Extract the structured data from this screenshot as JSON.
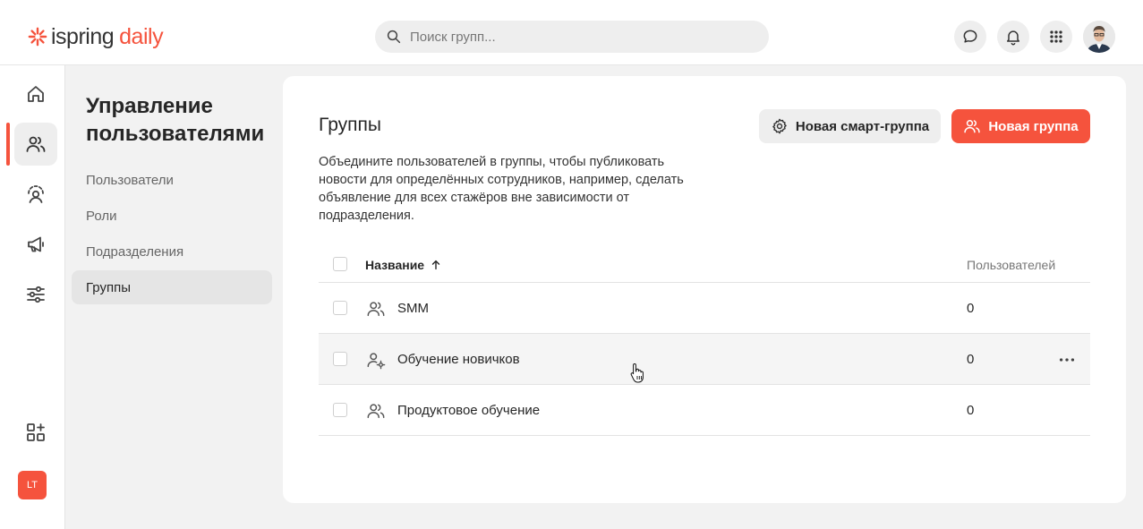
{
  "brand": {
    "name_part1": "ispring",
    "name_part2": "daily",
    "accent": "#f5533d"
  },
  "search": {
    "placeholder": "Поиск групп..."
  },
  "header_icons": [
    "chat-icon",
    "bell-icon",
    "apps-grid-icon"
  ],
  "rail": {
    "items": [
      "home-icon",
      "users-icon",
      "trainee-icon",
      "megaphone-icon",
      "settings-sliders-icon"
    ],
    "active": "users-icon",
    "bottom_icon": "add-widget-icon",
    "user_badge": "LT"
  },
  "subnav": {
    "title": "Управление пользователями",
    "items": [
      {
        "label": "Пользователи",
        "active": false
      },
      {
        "label": "Роли",
        "active": false
      },
      {
        "label": "Подразделения",
        "active": false
      },
      {
        "label": "Группы",
        "active": true
      }
    ]
  },
  "main": {
    "title": "Группы",
    "description": "Объедините пользователей в группы, чтобы публиковать новости для определённых сотрудников, например, сделать объявление для всех стажёров вне зависимости от подразделения.",
    "smart_group_button": "Новая смарт-группа",
    "new_group_button": "Новая группа",
    "table": {
      "col_name": "Название",
      "col_users": "Пользователей",
      "sort": "ascending",
      "rows": [
        {
          "name": "SMM",
          "users": "0",
          "icon": "users-icon"
        },
        {
          "name": "Обучение новичков",
          "users": "0",
          "icon": "smart-group-icon"
        },
        {
          "name": "Продуктовое обучение",
          "users": "0",
          "icon": "users-icon"
        }
      ]
    }
  }
}
